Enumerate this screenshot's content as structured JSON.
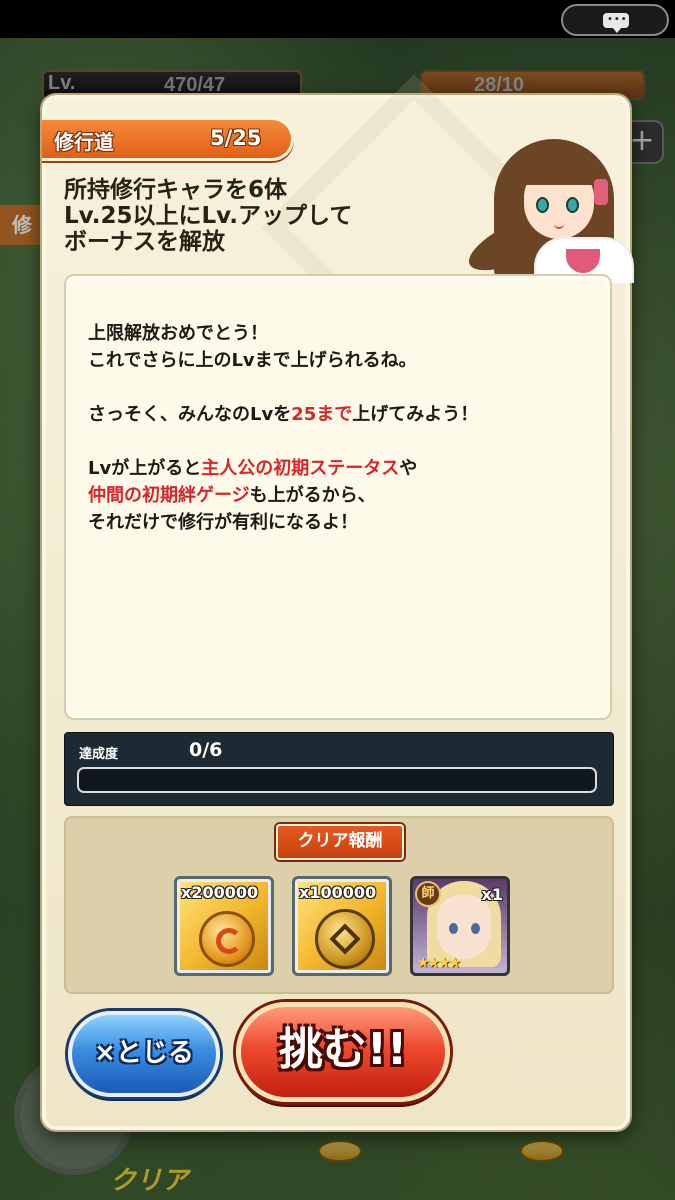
{
  "hud": {
    "lv_label": "Lv.",
    "lv_value": "470/47",
    "stamina_value": "28/10",
    "plus": "+",
    "left_tag": "修",
    "bottom_clear": "クリア"
  },
  "dialog": {
    "stage_name": "修行道",
    "stage_progress": "5/25",
    "mission_lines": [
      "所持修行キャラを6体",
      "Lv.25以上にLv.アップして",
      "ボーナスを解放"
    ],
    "message": {
      "line1": "上限解放おめでとう！",
      "line2": "これでさらに上のLvまで上げられるね。",
      "line3_pre": "さっそく、みんなのLvを",
      "line3_hl": "25まで",
      "line3_post": "上げてみよう！",
      "line4_pre": "Lvが上がると",
      "line4_hl": "主人公の初期ステータス",
      "line4_post": "や",
      "line5_hl": "仲間の初期絆ゲージ",
      "line5_post": "も上がるから、",
      "line6": "それだけで修行が有利になるよ！",
      "highlight_color": "#d7262a"
    },
    "progress": {
      "label": "達成度",
      "count": "0/6",
      "fraction": 0
    },
    "rewards": {
      "header": "クリア報酬",
      "items": [
        {
          "qty": "x200000",
          "icon": "gold-coin-icon"
        },
        {
          "qty": "x100000",
          "icon": "medal-icon"
        },
        {
          "qty": "x1",
          "badge": "師",
          "stars": "★★★★",
          "icon": "character-portrait"
        }
      ]
    },
    "buttons": {
      "close": "×とじる",
      "challenge": "挑む!!"
    }
  }
}
